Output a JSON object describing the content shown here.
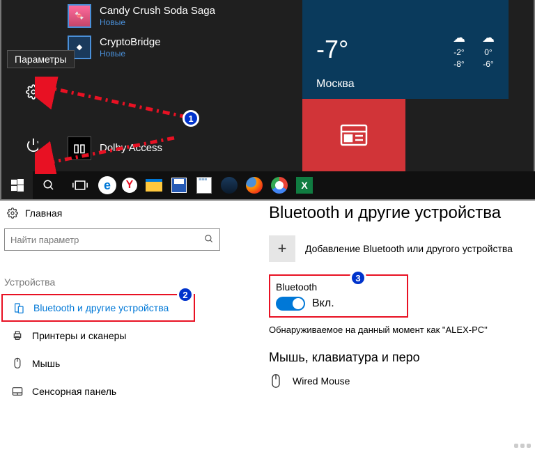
{
  "tooltip": "Параметры",
  "apps": {
    "candy": {
      "name": "Candy Crush Soda Saga",
      "sub": "Новые"
    },
    "crypto": {
      "name": "CryptoBridge",
      "sub": "Новые"
    },
    "dolby": {
      "name": "Dolby Access",
      "icon_text": "▯▯"
    }
  },
  "weather": {
    "temp": "-7°",
    "city": "Москва",
    "d1_hi": "-2°",
    "d1_lo": "-8°",
    "d2_hi": "0°",
    "d2_lo": "-6°"
  },
  "badges": {
    "b1": "1",
    "b2": "2",
    "b3": "3"
  },
  "settings": {
    "home": "Главная",
    "search_placeholder": "Найти параметр",
    "category": "Устройства",
    "nav": {
      "bluetooth": "Bluetooth и другие устройства",
      "printers": "Принтеры и сканеры",
      "mouse": "Мышь",
      "touchpad": "Сенсорная панель"
    },
    "page_title": "Bluetooth и другие устройства",
    "add_device": "Добавление Bluetooth или другого устройства",
    "bt_label": "Bluetooth",
    "bt_state": "Вкл.",
    "discoverable": "Обнаруживаемое на данный момент как \"ALEX-PC\"",
    "section_mouse": "Мышь, клавиатура и перо",
    "device1": "Wired Mouse"
  }
}
